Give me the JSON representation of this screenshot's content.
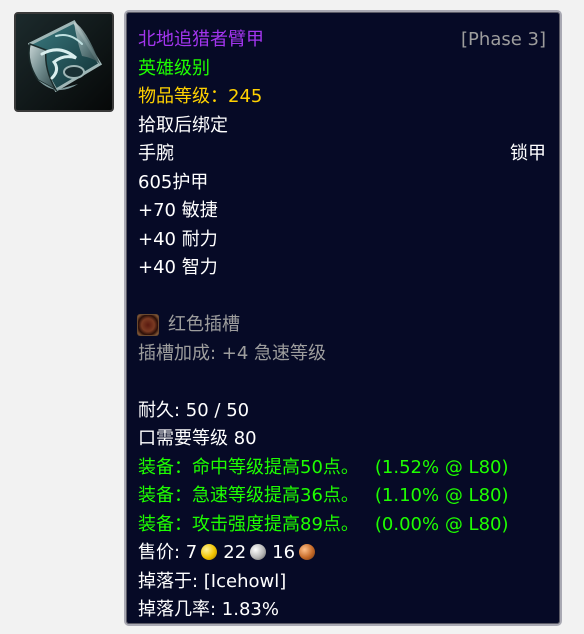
{
  "icon": {
    "name": "bracer-icon"
  },
  "tooltip": {
    "item_name": "北地追猎者臂甲",
    "phase": "[Phase 3]",
    "quality": "英雄级别",
    "item_level_label": "物品等级：",
    "item_level_value": "245",
    "bind": "拾取后绑定",
    "slot": "手腕",
    "armor_type": "锁甲",
    "armor": "605护甲",
    "stats": [
      "+70 敏捷",
      "+40 耐力",
      "+40 智力"
    ],
    "socket": {
      "label": "红色插槽",
      "icon": "red-socket-icon"
    },
    "socket_bonus": "插槽加成: +4 急速等级",
    "durability": "耐久: 50 / 50",
    "required_level": "口需要等级 80",
    "equip_effects": [
      {
        "text": "装备：命中等级提高50点。",
        "suffix": "(1.52% @ L80)"
      },
      {
        "text": "装备：急速等级提高36点。",
        "suffix": "(1.10% @ L80)"
      },
      {
        "text": "装备：攻击强度提高89点。",
        "suffix": "(0.00% @ L80)"
      }
    ],
    "sell_price": {
      "label": "售价: ",
      "gold": "7",
      "silver": "22",
      "copper": "16",
      "colors": {
        "gold": "#f2c300",
        "silver": "#b8b8b8",
        "copper": "#c56a28"
      }
    },
    "dropped_by": "掉落于: [Icehowl]",
    "drop_chance": "掉落几率: 1.83%"
  },
  "colors": {
    "epic": "#a335ee",
    "uncommon": "#1eff00",
    "gray": "#9d9d9d",
    "item_level": "#ffd100",
    "tooltip_bg": "#060a26"
  }
}
